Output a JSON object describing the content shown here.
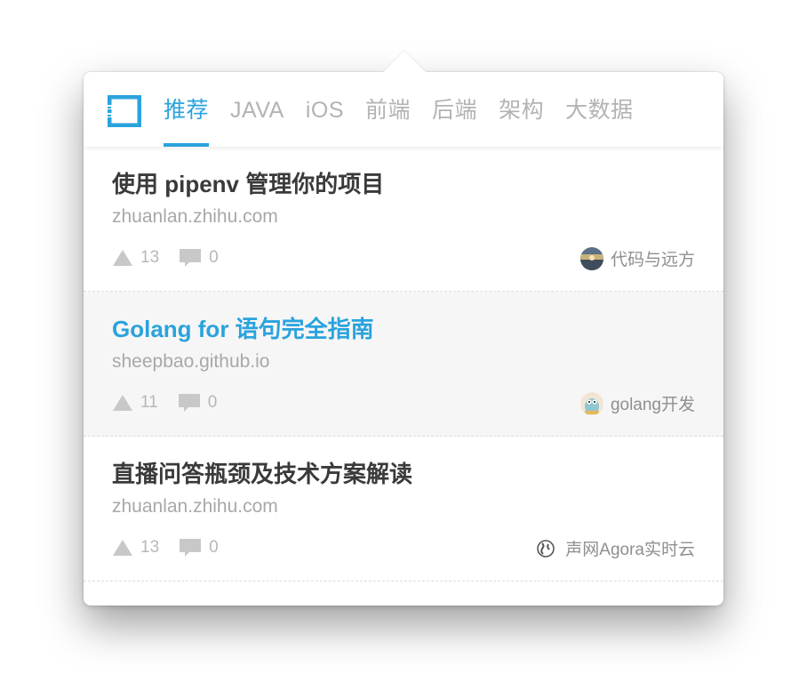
{
  "tabs": [
    "推荐",
    "JAVA",
    "iOS",
    "前端",
    "后端",
    "架构",
    "大数据"
  ],
  "active_tab": "推荐",
  "accent_color": "#2aa3dd",
  "articles": [
    {
      "title": "使用 pipenv 管理你的项目",
      "domain": "zhuanlan.zhihu.com",
      "likes": "13",
      "comments": "0",
      "author": "代码与远方",
      "avatar": "landscape-avatar",
      "highlighted": false
    },
    {
      "title": "Golang for 语句完全指南",
      "domain": "sheepbao.github.io",
      "likes": "11",
      "comments": "0",
      "author": "golang开发",
      "avatar": "gopher-avatar",
      "highlighted": true
    },
    {
      "title": "直播问答瓶颈及技术方案解读",
      "domain": "zhuanlan.zhihu.com",
      "likes": "13",
      "comments": "0",
      "author": "声网Agora实时云",
      "avatar": "globe-avatar",
      "highlighted": false
    }
  ]
}
